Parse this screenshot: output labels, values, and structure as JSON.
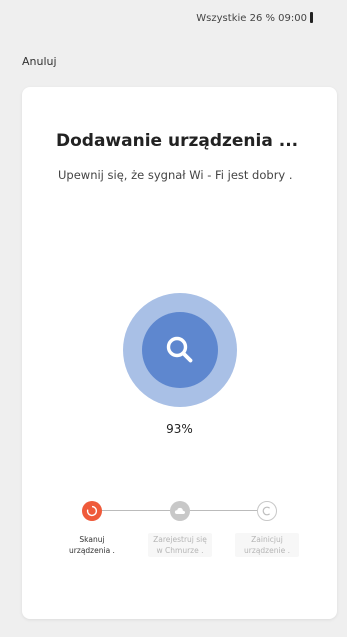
{
  "status_bar": {
    "text": "Wszystkie 26 % 09:00"
  },
  "header": {
    "cancel_label": "Anuluj"
  },
  "main": {
    "title": "Dodawanie urządzenia ...",
    "subtitle": "Upewnij się, że sygnał Wi - Fi jest dobry .",
    "progress_percent": "93%",
    "progress_value": 0.93
  },
  "steps": [
    {
      "label": "Skanuj urządzenia .",
      "state": "active",
      "icon": "scan-refresh-icon"
    },
    {
      "label": "Zarejestruj się w Chmurze .",
      "state": "pending",
      "icon": "cloud-icon"
    },
    {
      "label": "Zainicjuj urządzenie .",
      "state": "pending",
      "icon": "init-icon"
    }
  ],
  "colors": {
    "scan_ring": "#a9c0e6",
    "scan_inner": "#5e87cf",
    "active_step": "#ef5a3a",
    "pending_step": "#c8c8c8"
  }
}
